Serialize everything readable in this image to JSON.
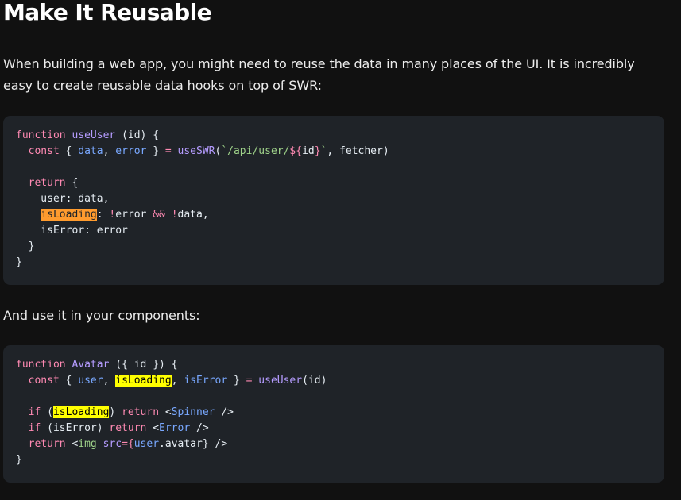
{
  "heading": "Make It Reusable",
  "intro": "When building a web app, you might need to reuse the data in many places of the UI. It is incredibly easy to create reusable data hooks on top of SWR:",
  "usage_text": "And use it in your components:",
  "code1": {
    "l1": [
      "function",
      " ",
      "useUser",
      " (id) {"
    ],
    "l2": [
      "  ",
      "const",
      " { ",
      "data",
      ", ",
      "error",
      " } ",
      "=",
      " ",
      "useSWR",
      "(",
      "`/api/user/",
      "${",
      "id",
      "}",
      "`",
      ", fetcher)"
    ],
    "l4": [
      "  ",
      "return",
      " {"
    ],
    "l5": [
      "    user",
      ": data,"
    ],
    "l6": [
      "    ",
      "isLoading",
      ": ",
      "!",
      "error ",
      "&&",
      " ",
      "!",
      "data,"
    ],
    "l7": [
      "    isError",
      ": error"
    ],
    "l8": [
      "  }"
    ],
    "l9": [
      "}"
    ]
  },
  "code2": {
    "l1": [
      "function",
      " ",
      "Avatar",
      " ({ id }) {"
    ],
    "l2": [
      "  ",
      "const",
      " { ",
      "user",
      ", ",
      "isLoading",
      ", ",
      "isError",
      " } ",
      "=",
      " ",
      "useUser",
      "(id)"
    ],
    "l4": [
      "  ",
      "if",
      " (",
      "isLoading",
      ") ",
      "return",
      " <",
      "Spinner",
      " />"
    ],
    "l5": [
      "  ",
      "if",
      " (isError) ",
      "return",
      " <",
      "Error",
      " />"
    ],
    "l6": [
      "  ",
      "return",
      " <",
      "img",
      " ",
      "src",
      "=",
      "{",
      "user",
      ".avatar} />"
    ],
    "l7": [
      "}"
    ]
  },
  "colors": {
    "background": "#111111",
    "code_background": "#1f2328",
    "keyword": "#ff8ab3",
    "function": "#b59cff",
    "string": "#9fd38a",
    "variable": "#79a8ff",
    "highlight_orange": "#ff9b2e",
    "highlight_yellow": "#ffff00"
  }
}
